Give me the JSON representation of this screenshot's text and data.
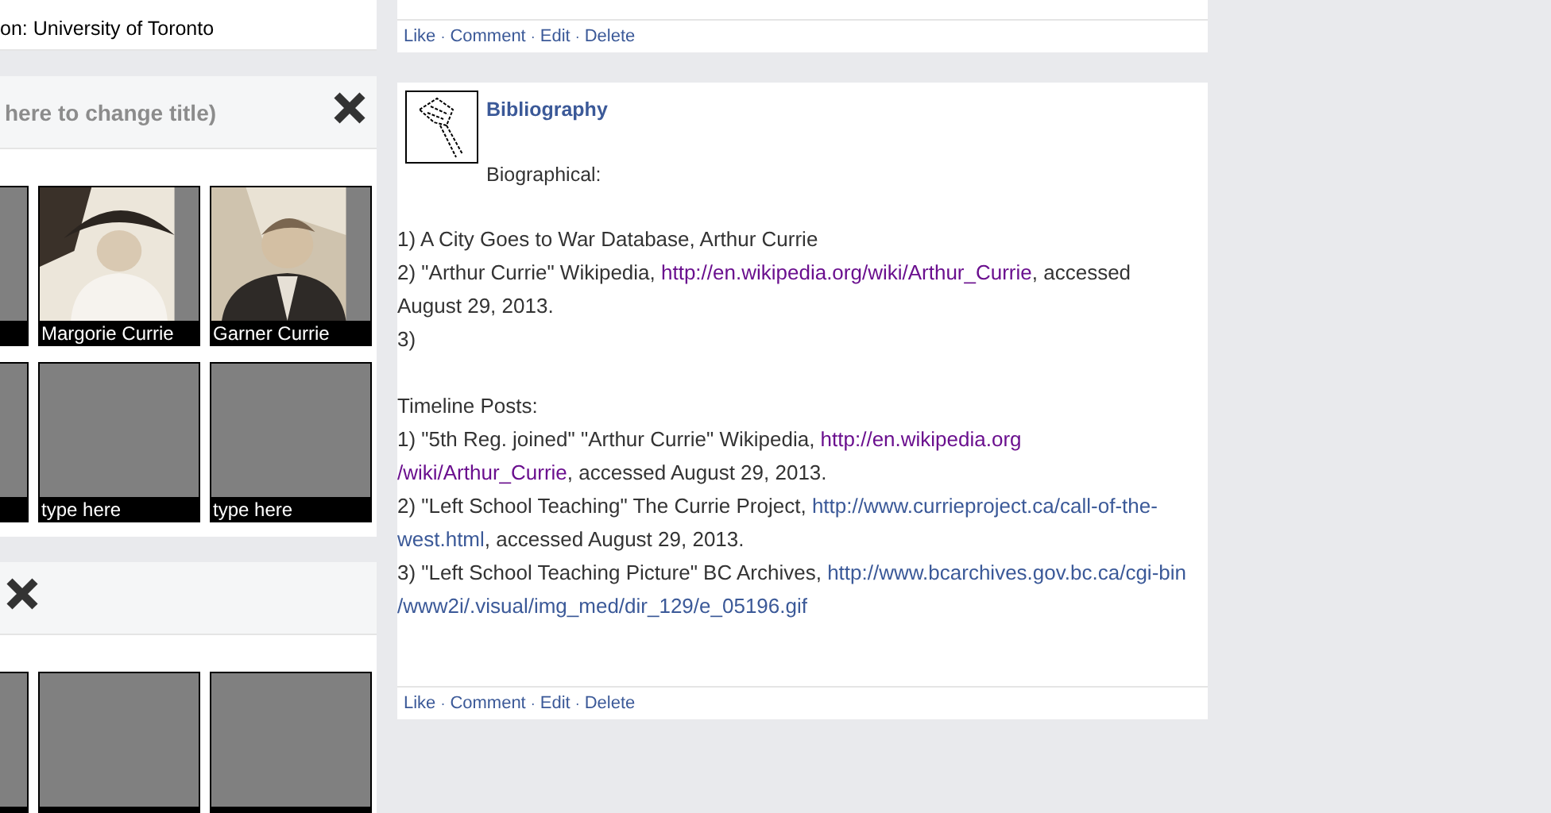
{
  "left_column": {
    "profile_line": "on: University of Toronto",
    "albums": [
      {
        "title": "here to change title)",
        "rows": [
          [
            {
              "kind": "empty"
            },
            {
              "caption": "Margorie Currie"
            },
            {
              "caption": "Garner Currie"
            }
          ],
          [
            {
              "kind": "empty"
            },
            {
              "kind": "empty",
              "caption": "type here"
            },
            {
              "kind": "empty",
              "caption": "type here"
            }
          ]
        ]
      },
      {
        "rows": [
          [
            {
              "kind": "empty"
            },
            {
              "kind": "empty"
            },
            {
              "kind": "empty"
            }
          ]
        ]
      }
    ]
  },
  "posts": [
    {
      "actions": [
        "Like",
        "Comment",
        "Edit",
        "Delete"
      ],
      "separator": "·"
    },
    {
      "title": "Bibliography",
      "intro": "Biographical:",
      "entries": [
        {
          "lines": [
            [
              {
                "kind": "text",
                "text": "1) A City Goes to War Database, Arthur Currie"
              }
            ]
          ]
        },
        {
          "lines": [
            [
              {
                "kind": "text",
                "text": "2) \"Arthur Currie\" Wikipedia, "
              },
              {
                "kind": "link",
                "text": "http://en.wikipedia.org/wiki/Arthur_Currie",
                "visited": true
              },
              {
                "kind": "text",
                "text": ", accessed"
              }
            ],
            [
              {
                "kind": "text",
                "text": "August 29, 2013."
              }
            ]
          ]
        },
        {
          "lines": [
            [
              {
                "kind": "text",
                "text": "3)"
              }
            ]
          ]
        }
      ],
      "timeline_heading": "Timeline Posts:",
      "timeline_entries": [
        {
          "lines": [
            [
              {
                "kind": "text",
                "text": "1) \"5th Reg. joined\" \"Arthur Currie\" Wikipedia, "
              },
              {
                "kind": "link",
                "text": "http://en.wikipedia.org",
                "visited": true
              }
            ],
            [
              {
                "kind": "link",
                "text": "/wiki/Arthur_Currie",
                "visited": true
              },
              {
                "kind": "text",
                "text": ", accessed August 29, 2013."
              }
            ]
          ]
        },
        {
          "lines": [
            [
              {
                "kind": "text",
                "text": "2) \"Left School Teaching\" The Currie Project, "
              },
              {
                "kind": "link",
                "text": "http://www.currieproject.ca/call-of-the-",
                "visited": false
              }
            ],
            [
              {
                "kind": "link",
                "text": "west.html",
                "visited": false
              },
              {
                "kind": "text",
                "text": ", accessed August 29, 2013."
              }
            ]
          ]
        },
        {
          "lines": [
            [
              {
                "kind": "text",
                "text": "3) \"Left School Teaching Picture\" BC Archives, "
              },
              {
                "kind": "link",
                "text": "http://www.bcarchives.gov.bc.ca/cgi-bin",
                "visited": false
              }
            ],
            [
              {
                "kind": "link",
                "text": "/www2i/.visual/img_med/dir_129/e_05196.gif",
                "visited": false
              }
            ]
          ]
        }
      ],
      "actions": [
        "Like",
        "Comment",
        "Edit",
        "Delete"
      ],
      "separator": "·"
    }
  ]
}
